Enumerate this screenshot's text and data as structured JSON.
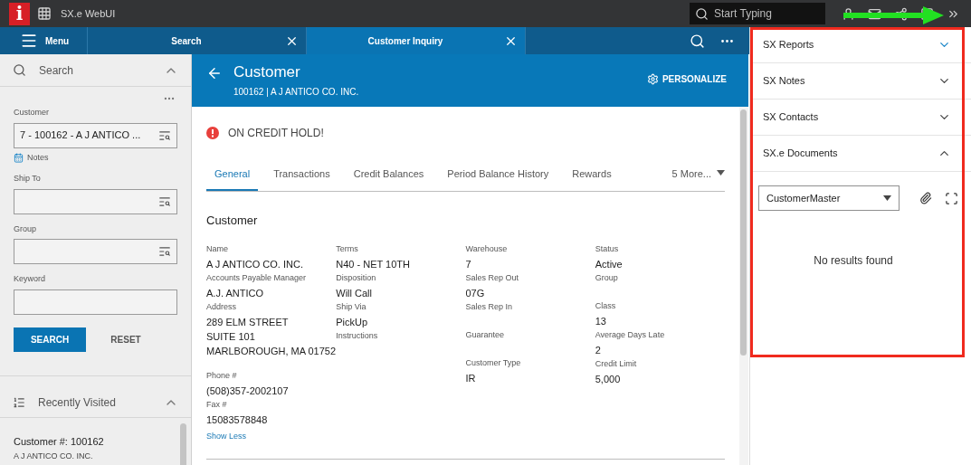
{
  "app": {
    "logo": "i",
    "title": "SX.e WebUI",
    "search_placeholder": "Start Typing"
  },
  "tab_bar": {
    "menu_label": "Menu",
    "tabs": [
      {
        "label": "Search",
        "selected": false
      },
      {
        "label": "Customer Inquiry",
        "selected": true
      }
    ]
  },
  "search_panel": {
    "title": "Search",
    "expanded": true,
    "fields": [
      {
        "label": "Customer",
        "value": "7 - 100162 - A J ANTICO ...",
        "lookup": true,
        "link": "Notes"
      },
      {
        "label": "Ship To",
        "lookup": true
      },
      {
        "label": "Group",
        "lookup": true
      },
      {
        "label": "Keyword",
        "lookup": false
      }
    ],
    "buttons": [
      {
        "label": "SEARCH",
        "kind": "primary"
      },
      {
        "label": "RESET",
        "kind": "secondary"
      }
    ]
  },
  "recently_visited": {
    "title": "Recently Visited",
    "expanded": true,
    "items": [
      {
        "title": "Customer #: 100162",
        "subtitle": "A J ANTICO CO. INC."
      }
    ]
  },
  "header": {
    "title": "Customer",
    "subtitle": "100162 | A J ANTICO CO. INC.",
    "action": "PERSONALIZE"
  },
  "alert": "ON CREDIT HOLD!",
  "tabs": [
    {
      "label": "General",
      "selected": true
    },
    {
      "label": "Transactions",
      "selected": false
    },
    {
      "label": "Credit Balances",
      "selected": false
    },
    {
      "label": "Period Balance History",
      "selected": false
    },
    {
      "label": "Rewards",
      "selected": false
    }
  ],
  "more_tab": "5 More...",
  "section": {
    "title": "Customer",
    "toggle": "Show Less",
    "columns": [
      [
        {
          "label": "Name",
          "values": [
            "A J ANTICO CO. INC."
          ]
        },
        {
          "label": "Accounts Payable Manager",
          "values": [
            "A.J. ANTICO"
          ]
        },
        {
          "label": "Address",
          "values": [
            "289 ELM STREET",
            "SUITE 101",
            "MARLBOROUGH, MA 01752"
          ]
        },
        {
          "label": "Phone #",
          "values": [
            "(508)357-2002107"
          ]
        },
        {
          "label": "Fax #",
          "values": [
            "15083578848"
          ]
        }
      ],
      [
        {
          "label": "Terms",
          "values": [
            "N40 - NET 10TH"
          ]
        },
        {
          "label": "Disposition",
          "values": [
            "Will Call"
          ]
        },
        {
          "label": "Ship Via",
          "values": [
            "PickUp"
          ]
        },
        {
          "label": "Instructions"
        }
      ],
      [
        {
          "label": "Warehouse",
          "values": [
            "7"
          ]
        },
        {
          "label": "Sales Rep Out",
          "values": [
            "07G"
          ]
        },
        {
          "label": "Sales Rep In"
        },
        {
          "label": "Guarantee"
        },
        {
          "label": "Customer Type",
          "values": [
            "IR"
          ]
        }
      ],
      [
        {
          "label": "Status",
          "values": [
            "Active"
          ]
        },
        {
          "label": "Group"
        },
        {
          "label": "Class",
          "values": [
            "13"
          ]
        },
        {
          "label": "Average Days Late",
          "values": [
            "2"
          ]
        },
        {
          "label": "Credit Limit",
          "values": [
            "5,000"
          ]
        }
      ]
    ]
  },
  "right_panel": {
    "items": [
      {
        "title": "SX Reports",
        "expanded": false,
        "focused": true
      },
      {
        "title": "SX Notes",
        "expanded": false,
        "focused": false
      },
      {
        "title": "SX Contacts",
        "expanded": false,
        "focused": false
      },
      {
        "title": "SX.e Documents",
        "expanded": true,
        "focused": false,
        "content": {
          "select": "CustomerMaster",
          "empty_text": "No results found"
        }
      }
    ]
  }
}
